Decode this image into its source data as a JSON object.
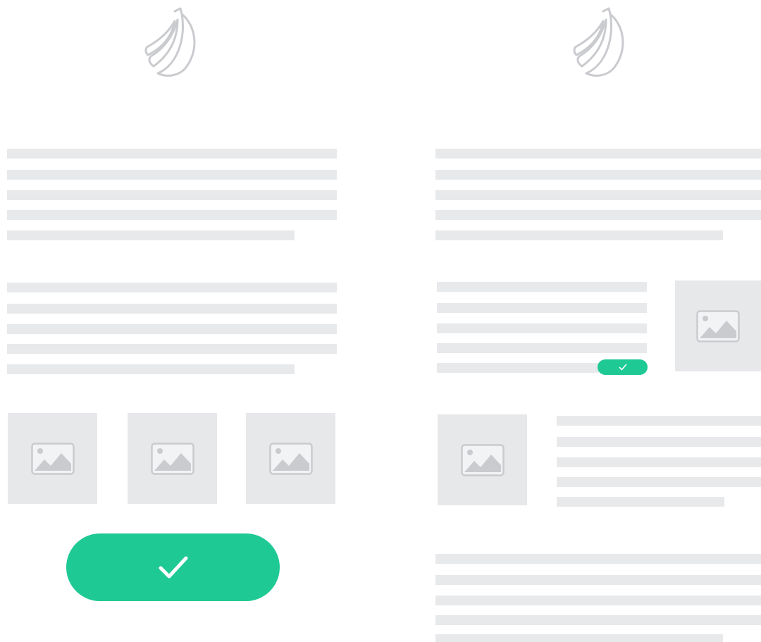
{
  "icons": {
    "logo": "banana-icon",
    "image_placeholder": "image-placeholder-icon",
    "confirm": "check-icon"
  },
  "colors": {
    "accent": "#1ec994",
    "placeholder_fill": "#e8e9eb",
    "icon_stroke": "#c9cbce"
  }
}
